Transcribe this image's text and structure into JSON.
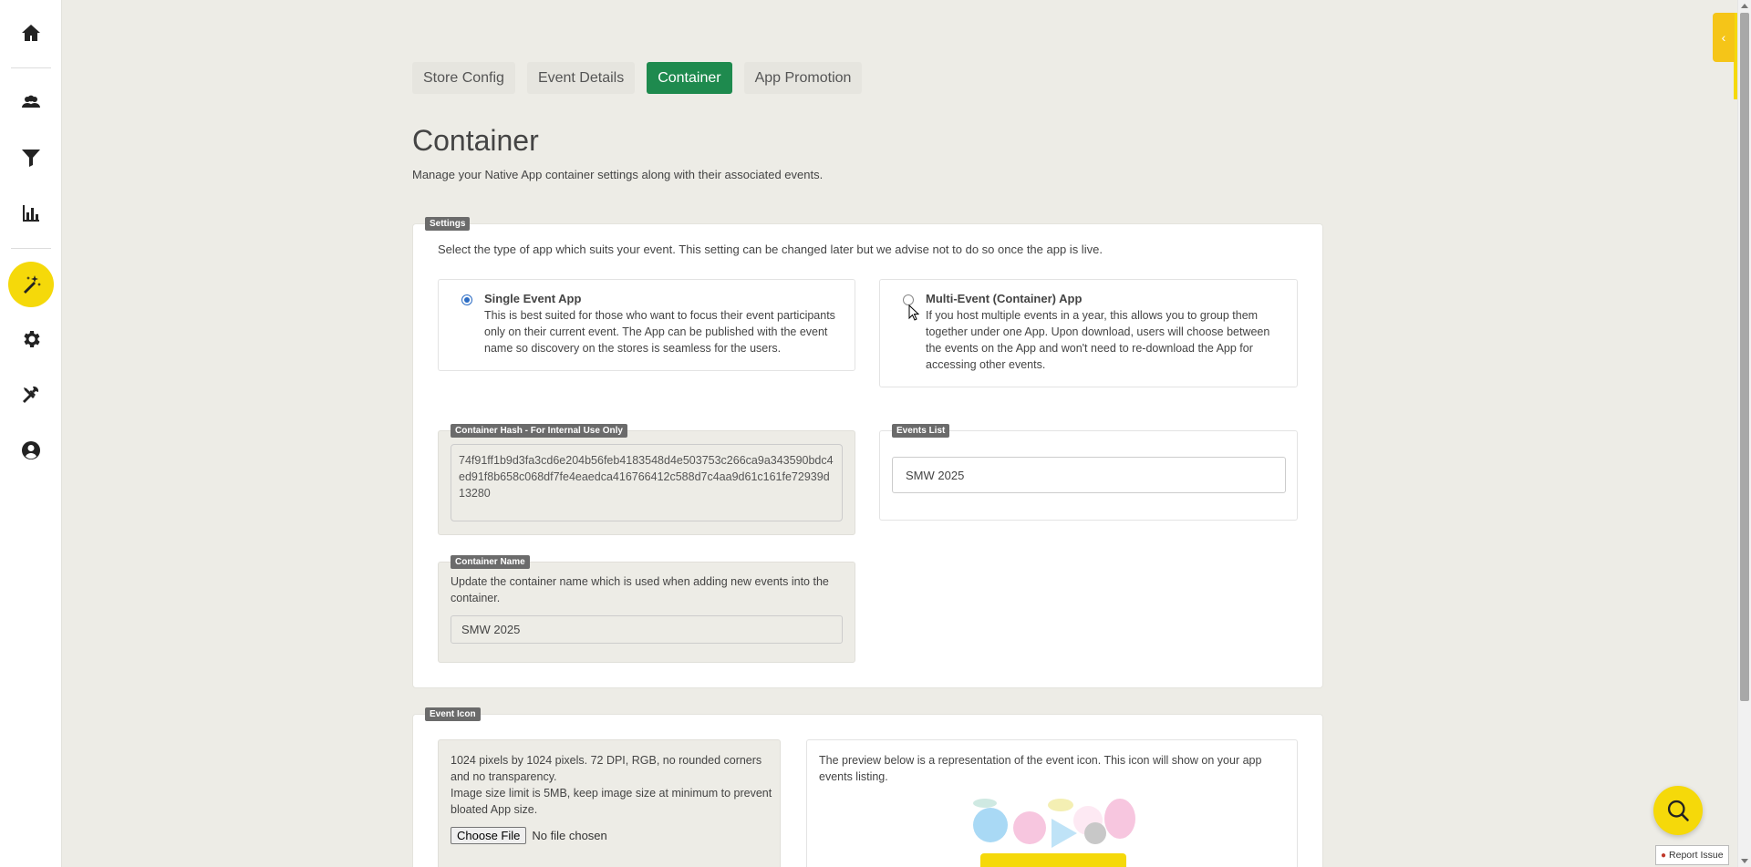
{
  "nav": {
    "items": [
      {
        "icon": "home-icon"
      },
      {
        "icon": "users-icon"
      },
      {
        "icon": "filter-icon"
      },
      {
        "icon": "bar-chart-icon"
      },
      {
        "icon": "magic-wand-icon",
        "active": true
      },
      {
        "icon": "gear-icon"
      },
      {
        "icon": "tools-icon"
      },
      {
        "icon": "user-circle-icon"
      }
    ]
  },
  "tabs": [
    {
      "label": "Store Config",
      "active": false
    },
    {
      "label": "Event Details",
      "active": false
    },
    {
      "label": "Container",
      "active": true
    },
    {
      "label": "App Promotion",
      "active": false
    }
  ],
  "page": {
    "title": "Container",
    "subtitle": "Manage your Native App container settings along with their associated events."
  },
  "settings": {
    "legend": "Settings",
    "description": "Select the type of app which suits your event. This setting can be changed later but we advise not to do so once the app is live.",
    "single": {
      "title": "Single Event App",
      "text": "This is best suited for those who want to focus their event participants only on their current event. The App can be published with the event name so discovery on the stores is seamless for the users.",
      "checked": true
    },
    "multi": {
      "title": "Multi-Event (Container) App",
      "text": "If you host multiple events in a year, this allows you to group them together under one App. Upon download, users will choose between the events on the App and won't need to re-download the App for accessing other events.",
      "checked": false
    },
    "hash": {
      "legend": "Container Hash - For Internal Use Only",
      "value": "74f91ff1b9d3fa3cd6e204b56feb4183548d4e503753c266ca9a343590bdc4ed91f8b658c068df7fe4eaedca416766412c588d7c4aa9d61c161fe72939d13280"
    },
    "events_list": {
      "legend": "Events List",
      "value": "SMW 2025"
    },
    "container_name": {
      "legend": "Container Name",
      "help": "Update the container name which is used when adding new events into the container.",
      "value": "SMW 2025"
    }
  },
  "event_icon": {
    "legend": "Event Icon",
    "requirements": "1024 pixels by 1024 pixels. 72 DPI, RGB, no rounded corners and no transparency.",
    "size_limit": "Image size limit is 5MB, keep image size at minimum to prevent bloated App size.",
    "choose_label": "Choose File",
    "no_file": "No file chosen",
    "preview_text": "The preview below is a representation of the event icon. This icon will show on your app events listing."
  },
  "report_issue": "Report Issue",
  "colors": {
    "accent_green": "#1e8a4e",
    "accent_yellow": "#f5d90a",
    "radio_blue": "#2b6cc4"
  }
}
